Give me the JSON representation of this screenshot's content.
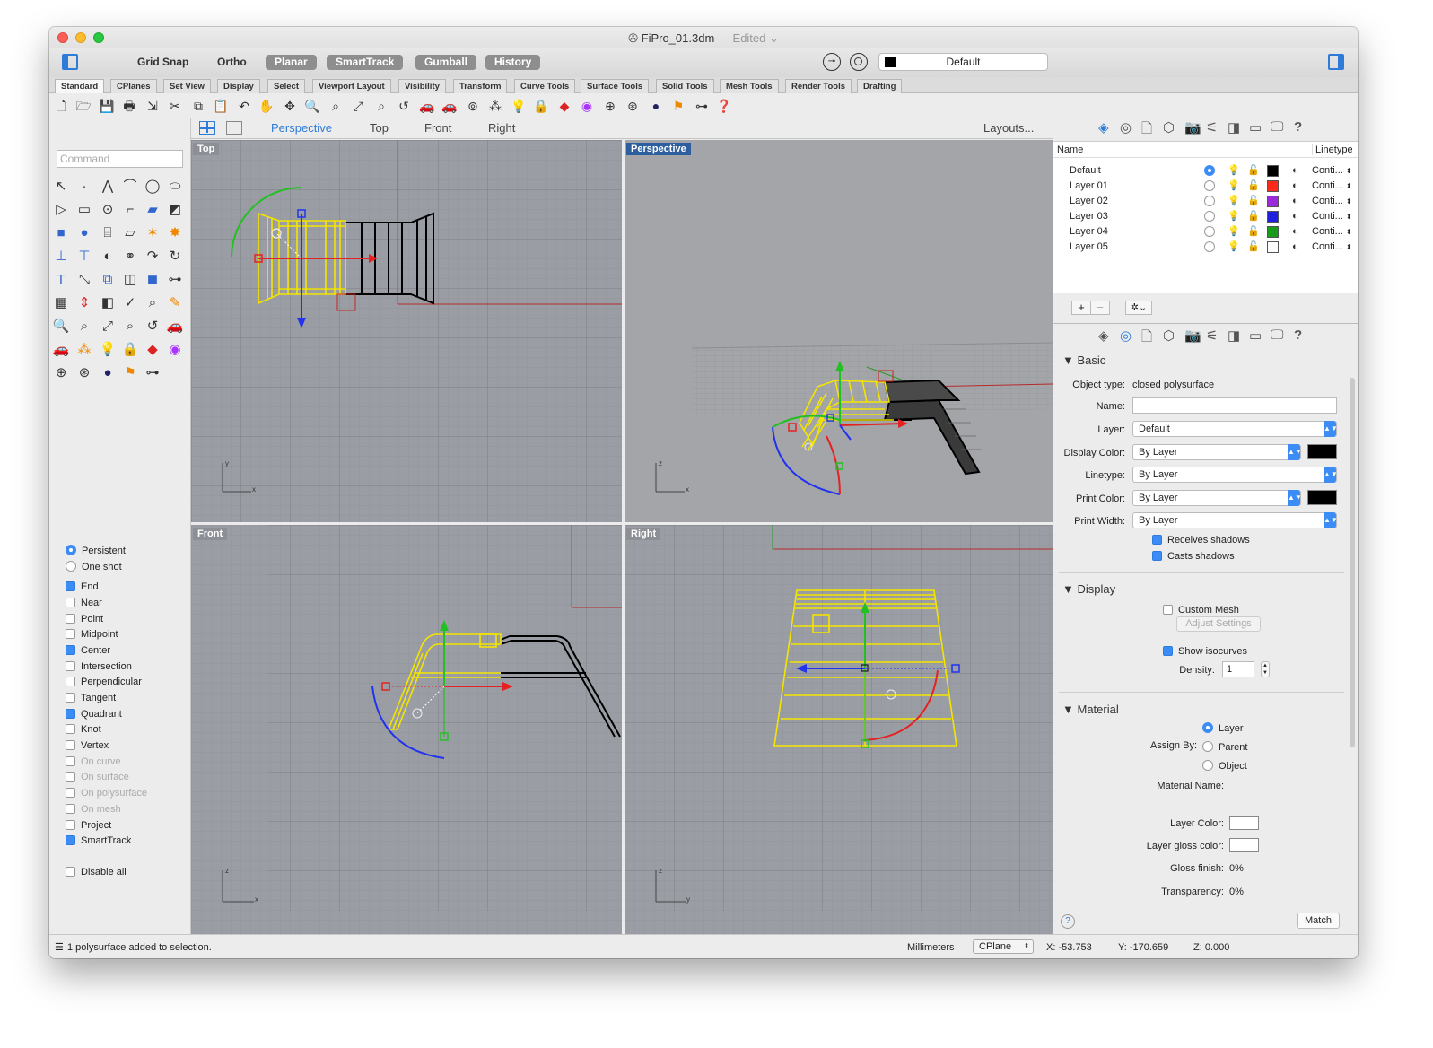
{
  "window": {
    "title": "FiPro_01.3dm",
    "edited": "— Edited ⌄"
  },
  "toolbar": {
    "grid_snap": "Grid Snap",
    "ortho": "Ortho",
    "planar": "Planar",
    "smarttrack": "SmartTrack",
    "gumball": "Gumball",
    "history": "History",
    "layer": "Default"
  },
  "tabs": [
    "Standard",
    "CPlanes",
    "Set View",
    "Display",
    "Select",
    "Viewport Layout",
    "Visibility",
    "Transform",
    "Curve Tools",
    "Surface Tools",
    "Solid Tools",
    "Mesh Tools",
    "Render Tools",
    "Drafting"
  ],
  "viewport_tabs": {
    "perspective": "Perspective",
    "top": "Top",
    "front": "Front",
    "right": "Right",
    "layouts": "Layouts..."
  },
  "viewports": {
    "top": "Top",
    "perspective": "Perspective",
    "front": "Front",
    "right": "Right"
  },
  "command": {
    "placeholder": "Command"
  },
  "osnap": {
    "modes": [
      {
        "label": "Persistent",
        "type": "radio",
        "on": true
      },
      {
        "label": "One shot",
        "type": "radio",
        "on": false
      }
    ],
    "items": [
      {
        "label": "End",
        "on": true,
        "disabled": false
      },
      {
        "label": "Near",
        "on": false,
        "disabled": false
      },
      {
        "label": "Point",
        "on": false,
        "disabled": false
      },
      {
        "label": "Midpoint",
        "on": false,
        "disabled": false
      },
      {
        "label": "Center",
        "on": true,
        "disabled": false
      },
      {
        "label": "Intersection",
        "on": false,
        "disabled": false
      },
      {
        "label": "Perpendicular",
        "on": false,
        "disabled": false
      },
      {
        "label": "Tangent",
        "on": false,
        "disabled": false
      },
      {
        "label": "Quadrant",
        "on": true,
        "disabled": false
      },
      {
        "label": "Knot",
        "on": false,
        "disabled": false
      },
      {
        "label": "Vertex",
        "on": false,
        "disabled": false
      },
      {
        "label": "On curve",
        "on": false,
        "disabled": true
      },
      {
        "label": "On surface",
        "on": false,
        "disabled": true
      },
      {
        "label": "On polysurface",
        "on": false,
        "disabled": true
      },
      {
        "label": "On mesh",
        "on": false,
        "disabled": true
      },
      {
        "label": "Project",
        "on": false,
        "disabled": false
      },
      {
        "label": "SmartTrack",
        "on": true,
        "disabled": false
      }
    ],
    "disable_all": "Disable all"
  },
  "layers": {
    "col_name": "Name",
    "col_linetype": "Linetype",
    "rows": [
      {
        "name": "Default",
        "color": "#000000",
        "linetype": "Conti...",
        "current": true
      },
      {
        "name": "Layer 01",
        "color": "#ff2a1a",
        "linetype": "Conti...",
        "current": false
      },
      {
        "name": "Layer 02",
        "color": "#9b2bd9",
        "linetype": "Conti...",
        "current": false
      },
      {
        "name": "Layer 03",
        "color": "#1f1fe0",
        "linetype": "Conti...",
        "current": false
      },
      {
        "name": "Layer 04",
        "color": "#1a9a1a",
        "linetype": "Conti...",
        "current": false
      },
      {
        "name": "Layer 05",
        "color": "#ffffff",
        "linetype": "Conti...",
        "current": false
      }
    ]
  },
  "properties": {
    "basic": "Basic",
    "object_type_label": "Object type:",
    "object_type": "closed polysurface",
    "name_label": "Name:",
    "name_value": "",
    "layer_label": "Layer:",
    "layer_value": "Default",
    "display_color_label": "Display Color:",
    "display_color_value": "By Layer",
    "linetype_label": "Linetype:",
    "linetype_value": "By Layer",
    "print_color_label": "Print Color:",
    "print_color_value": "By Layer",
    "print_width_label": "Print Width:",
    "print_width_value": "By Layer",
    "receives_shadows": "Receives shadows",
    "casts_shadows": "Casts shadows",
    "display": "Display",
    "custom_mesh": "Custom Mesh",
    "adjust_settings": "Adjust Settings",
    "show_isocurves": "Show isocurves",
    "density_label": "Density:",
    "density_value": "1",
    "material": "Material",
    "assign_by_label": "Assign By:",
    "assign_layer": "Layer",
    "assign_parent": "Parent",
    "assign_object": "Object",
    "material_name_label": "Material Name:",
    "layer_color_label": "Layer Color:",
    "layer_gloss_label": "Layer gloss color:",
    "gloss_finish_label": "Gloss finish:",
    "gloss_finish_value": "0%",
    "transparency_label": "Transparency:",
    "transparency_value": "0%",
    "match": "Match"
  },
  "status": {
    "message": "1 polysurface added to selection.",
    "units": "Millimeters",
    "cplane": "CPlane",
    "x": "X: -53.753",
    "y": "Y: -170.659",
    "z": "Z: 0.000"
  },
  "colors": {
    "accent": "#3b8df5",
    "viewport_bg": "#9a9ea4",
    "selected": "#f4e500"
  }
}
